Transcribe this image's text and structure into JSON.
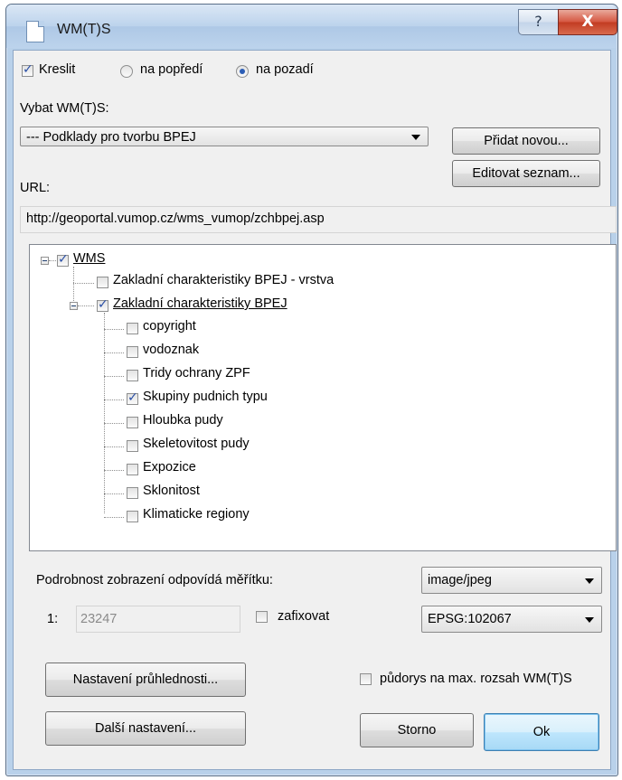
{
  "window": {
    "title": "WM(T)S",
    "help_glyph": "?",
    "close_glyph": "X"
  },
  "draw": {
    "kreslit_label": "Kreslit",
    "kreslit_checked": true,
    "foreground_label": "na popředí",
    "background_label": "na pozadí",
    "selected": "na pozadí"
  },
  "select_wms": {
    "label": "Vybat WM(T)S:",
    "value": "--- Podklady pro tvorbu BPEJ",
    "add_button": "Přidat novou...",
    "edit_button": "Editovat seznam..."
  },
  "url": {
    "label": "URL:",
    "value": "http://geoportal.vumop.cz/wms_vumop/zchbpej.asp"
  },
  "tree": {
    "root": {
      "label": "WMS",
      "checked": true
    },
    "layer_vrstva": {
      "label": "Zakladní charakteristiky BPEJ - vrstva",
      "checked": false
    },
    "group": {
      "label": "Zakladní charakteristiky BPEJ",
      "checked": true
    },
    "children": [
      {
        "label": "copyright",
        "checked": false
      },
      {
        "label": "vodoznak",
        "checked": false
      },
      {
        "label": "Tridy ochrany ZPF",
        "checked": false
      },
      {
        "label": "Skupiny pudnich typu",
        "checked": true
      },
      {
        "label": "Hloubka pudy",
        "checked": false
      },
      {
        "label": "Skeletovitost pudy",
        "checked": false
      },
      {
        "label": "Expozice",
        "checked": false
      },
      {
        "label": "Sklonitost",
        "checked": false
      },
      {
        "label": "Klimaticke regiony",
        "checked": false
      }
    ]
  },
  "scale": {
    "label": "Podrobnost zobrazení odpovídá měřítku:",
    "prefix": "1:",
    "value": "23247",
    "fix_label": "zafixovat",
    "fix_checked": false
  },
  "format": {
    "value": "image/jpeg"
  },
  "crs": {
    "value": "EPSG:102067"
  },
  "buttons": {
    "transparency": "Nastavení průhlednosti...",
    "more_settings": "Další nastavení...",
    "cancel": "Storno",
    "ok": "Ok"
  },
  "extent": {
    "label": "půdorys na max. rozsah WM(T)S",
    "checked": false
  }
}
